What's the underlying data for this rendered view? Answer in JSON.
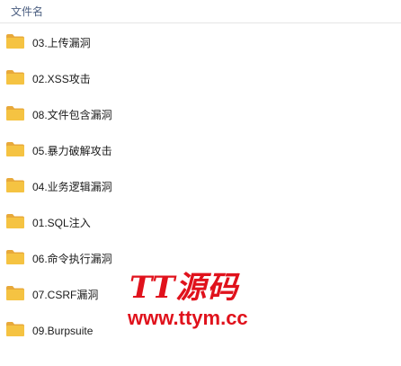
{
  "header": {
    "column_name": "文件名"
  },
  "files": [
    {
      "name": "03.上传漏洞",
      "icon": "folder-icon"
    },
    {
      "name": "02.XSS攻击",
      "icon": "folder-icon"
    },
    {
      "name": "08.文件包含漏洞",
      "icon": "folder-icon"
    },
    {
      "name": "05.暴力破解攻击",
      "icon": "folder-icon"
    },
    {
      "name": "04.业务逻辑漏洞",
      "icon": "folder-icon"
    },
    {
      "name": "01.SQL注入",
      "icon": "folder-icon"
    },
    {
      "name": "06.命令执行漏洞",
      "icon": "folder-icon"
    },
    {
      "name": "07.CSRF漏洞",
      "icon": "folder-icon"
    },
    {
      "name": "09.Burpsuite",
      "icon": "folder-icon"
    }
  ],
  "watermark": {
    "logo_text": "TT源码",
    "url": "www.ttym.cc"
  },
  "colors": {
    "folder": "#f5c342",
    "folder_dark": "#e8a93a",
    "header_text": "#4d6082",
    "watermark": "#e0121c"
  }
}
